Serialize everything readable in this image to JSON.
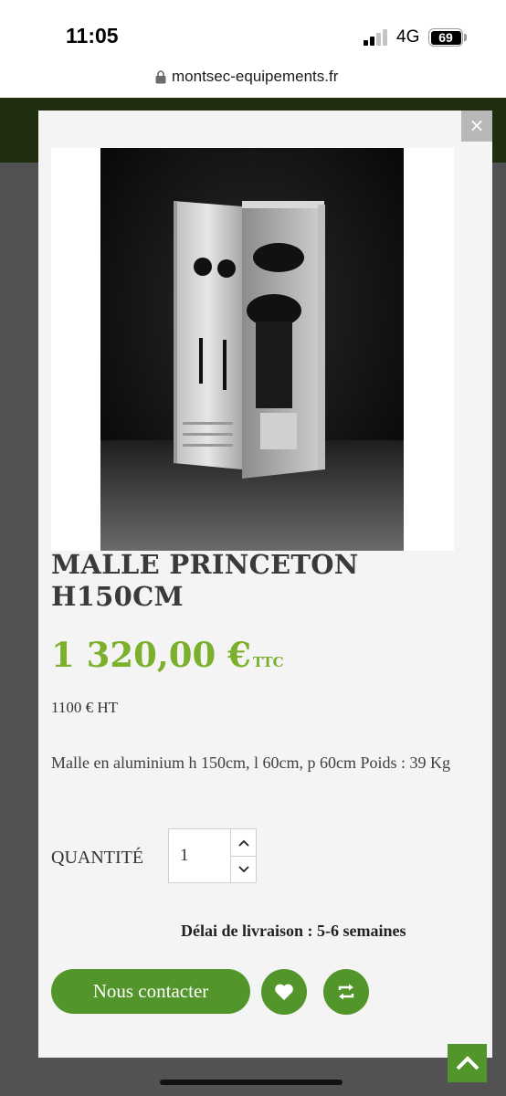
{
  "status_bar": {
    "time": "11:05",
    "network": "4G",
    "battery": "69"
  },
  "browser": {
    "url": "montsec-equipements.fr"
  },
  "modal": {
    "close_label": "×",
    "product": {
      "image_alt": "Malle Princeton aluminium ouverte avec selles",
      "title": "MALLE PRINCETON H150CM",
      "price": "1 320,00 €",
      "price_tax_label": "TTC",
      "price_ht": "1100 € HT",
      "description": "Malle en aluminium h 150cm, l 60cm, p 60cm Poids : 39 Kg",
      "quantity_label": "QUANTITÉ",
      "quantity_value": "1",
      "delivery_label": "Délai de livraison : ",
      "delivery_value": "5-6 semaines",
      "contact_label": "Nous contacter"
    },
    "icons": {
      "wishlist": "heart-icon",
      "compare": "compare-arrows-icon",
      "scroll_top": "chevron-up-icon"
    }
  },
  "colors": {
    "accent_green": "#52952a",
    "price_green": "#7cb02c",
    "header_dark_green": "#1f2d10",
    "overlay_grey": "#525252"
  }
}
